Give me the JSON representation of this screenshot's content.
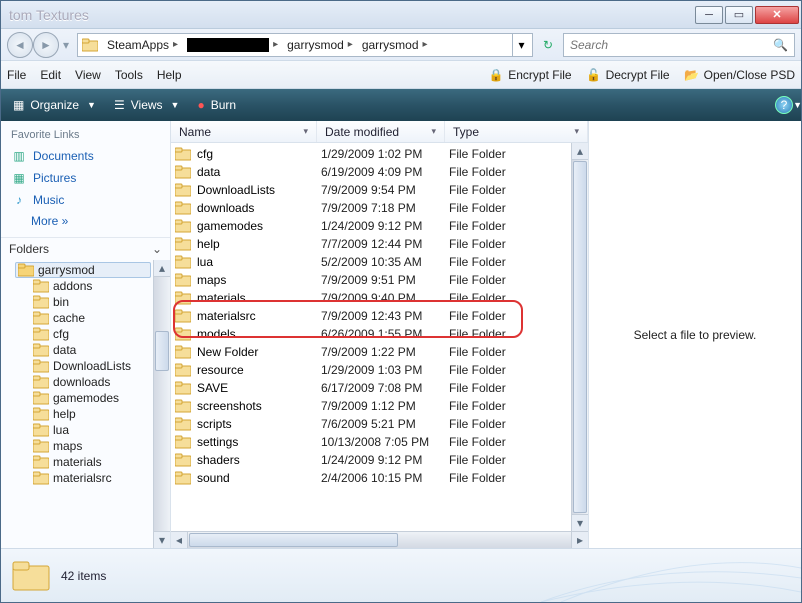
{
  "title": "tom Textures",
  "breadcrumb": {
    "items": [
      "SteamApps",
      "",
      "garrysmod",
      "garrysmod"
    ],
    "masked_index": 1
  },
  "search": {
    "placeholder": "Search"
  },
  "menu": {
    "file": "File",
    "edit": "Edit",
    "view": "View",
    "tools": "Tools",
    "help": "Help"
  },
  "tools_right": {
    "encrypt": "Encrypt File",
    "decrypt": "Decrypt File",
    "psd": "Open/Close PSD"
  },
  "cmdbar": {
    "organize": "Organize",
    "views": "Views",
    "burn": "Burn"
  },
  "favorites": {
    "heading": "Favorite Links",
    "links": [
      {
        "icon": "documents",
        "label": "Documents"
      },
      {
        "icon": "pictures",
        "label": "Pictures"
      },
      {
        "icon": "music",
        "label": "Music"
      }
    ],
    "more": "More  »"
  },
  "folders_header": "Folders",
  "tree": {
    "root": "garrysmod",
    "children": [
      "addons",
      "bin",
      "cache",
      "cfg",
      "data",
      "DownloadLists",
      "downloads",
      "gamemodes",
      "help",
      "lua",
      "maps",
      "materials",
      "materialsrc"
    ]
  },
  "columns": {
    "name": "Name",
    "date": "Date modified",
    "type": "Type"
  },
  "rows": [
    {
      "name": "cfg",
      "date": "1/29/2009 1:02 PM",
      "type": "File Folder"
    },
    {
      "name": "data",
      "date": "6/19/2009 4:09 PM",
      "type": "File Folder"
    },
    {
      "name": "DownloadLists",
      "date": "7/9/2009 9:54 PM",
      "type": "File Folder"
    },
    {
      "name": "downloads",
      "date": "7/9/2009 7:18 PM",
      "type": "File Folder"
    },
    {
      "name": "gamemodes",
      "date": "1/24/2009 9:12 PM",
      "type": "File Folder"
    },
    {
      "name": "help",
      "date": "7/7/2009 12:44 PM",
      "type": "File Folder"
    },
    {
      "name": "lua",
      "date": "5/2/2009 10:35 AM",
      "type": "File Folder"
    },
    {
      "name": "maps",
      "date": "7/9/2009 9:51 PM",
      "type": "File Folder"
    },
    {
      "name": "materials",
      "date": "7/9/2009 9:40 PM",
      "type": "File Folder"
    },
    {
      "name": "materialsrc",
      "date": "7/9/2009 12:43 PM",
      "type": "File Folder"
    },
    {
      "name": "models",
      "date": "6/26/2009 1:55 PM",
      "type": "File Folder"
    },
    {
      "name": "New Folder",
      "date": "7/9/2009 1:22 PM",
      "type": "File Folder"
    },
    {
      "name": "resource",
      "date": "1/29/2009 1:03 PM",
      "type": "File Folder"
    },
    {
      "name": "SAVE",
      "date": "6/17/2009 7:08 PM",
      "type": "File Folder"
    },
    {
      "name": "screenshots",
      "date": "7/9/2009 1:12 PM",
      "type": "File Folder"
    },
    {
      "name": "scripts",
      "date": "7/6/2009 5:21 PM",
      "type": "File Folder"
    },
    {
      "name": "settings",
      "date": "10/13/2008 7:05 PM",
      "type": "File Folder"
    },
    {
      "name": "shaders",
      "date": "1/24/2009 9:12 PM",
      "type": "File Folder"
    },
    {
      "name": "sound",
      "date": "2/4/2006 10:15 PM",
      "type": "File Folder"
    }
  ],
  "highlight_rows": [
    8,
    9
  ],
  "preview_text": "Select a file to preview.",
  "status": {
    "count_text": "42 items"
  }
}
